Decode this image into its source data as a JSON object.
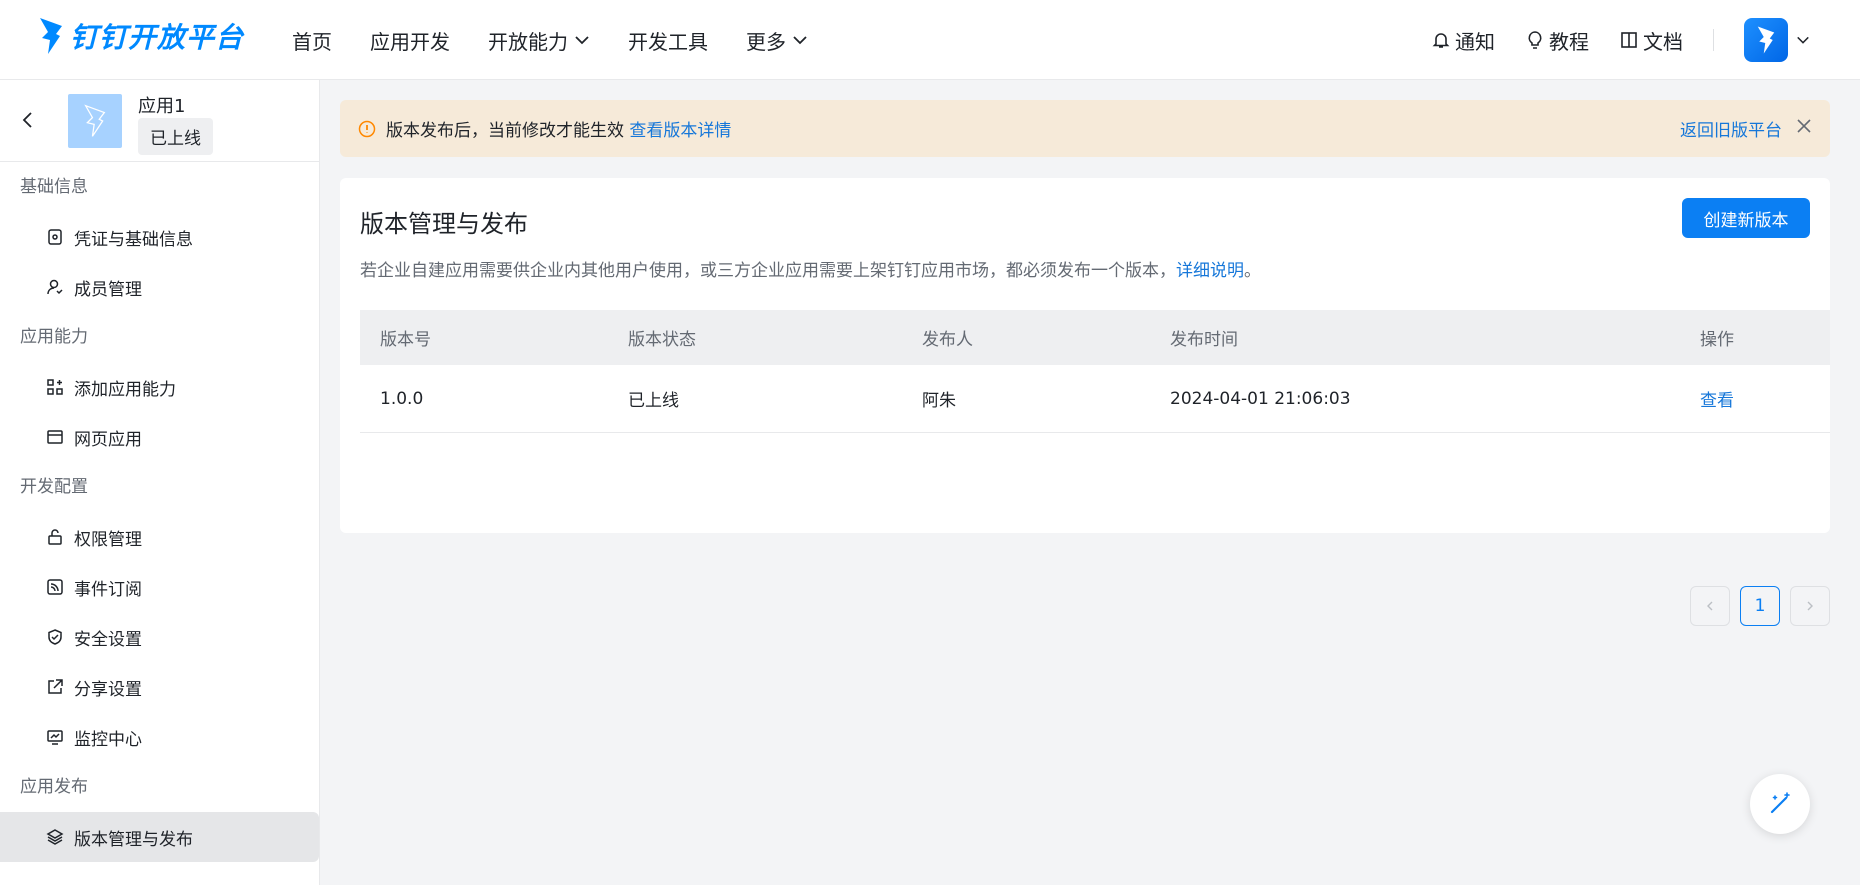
{
  "brand": {
    "name": "钉钉开放平台",
    "color": "#0089ff",
    "logo_icon": "dingtalk-bird-icon"
  },
  "nav": {
    "items": [
      {
        "label": "首页"
      },
      {
        "label": "应用开发"
      },
      {
        "label": "开放能力"
      },
      {
        "label": "开发工具"
      },
      {
        "label": "更多"
      }
    ]
  },
  "right_nav": {
    "notify": "通知",
    "tutorial": "教程",
    "docs": "文档"
  },
  "app": {
    "name": "应用1",
    "status": "已上线"
  },
  "sidebar": {
    "groups": [
      {
        "title": "基础信息",
        "items": [
          {
            "label": "凭证与基础信息"
          },
          {
            "label": "成员管理"
          }
        ]
      },
      {
        "title": "应用能力",
        "items": [
          {
            "label": "添加应用能力"
          },
          {
            "label": "网页应用"
          }
        ]
      },
      {
        "title": "开发配置",
        "items": [
          {
            "label": "权限管理"
          },
          {
            "label": "事件订阅"
          },
          {
            "label": "安全设置"
          },
          {
            "label": "分享设置"
          },
          {
            "label": "监控中心"
          }
        ]
      },
      {
        "title": "应用发布",
        "items": [
          {
            "label": "版本管理与发布"
          }
        ]
      }
    ]
  },
  "banner": {
    "text": "版本发布后，当前修改才能生效",
    "link": "查看版本详情",
    "back_link": "返回旧版平台"
  },
  "main": {
    "title": "版本管理与发布",
    "create_button": "创建新版本",
    "desc_text": "若企业自建应用需要供企业内其他用户使用，或三方企业应用需要上架钉钉应用市场，都必须发布一个版本，",
    "desc_link": "详细说明",
    "desc_end": "。",
    "table": {
      "headers": [
        "版本号",
        "版本状态",
        "发布人",
        "发布时间",
        "操作"
      ],
      "rows": [
        {
          "version": "1.0.0",
          "status": "已上线",
          "publisher": "阿朱",
          "time": "2024-04-01 21:06:03",
          "action": "查看"
        }
      ]
    },
    "pager": {
      "current": "1"
    }
  },
  "colors": {
    "accent": "#0b7ff3",
    "link": "#1677d9",
    "banner_bg": "#f6ead9",
    "warn_icon": "#ff8800"
  }
}
